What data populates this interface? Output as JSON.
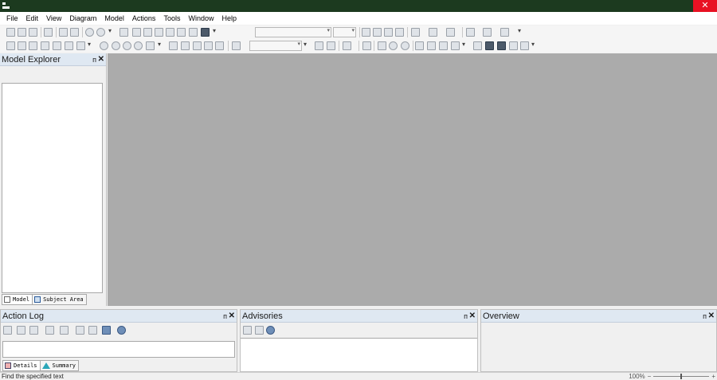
{
  "menu": [
    "File",
    "Edit",
    "View",
    "Diagram",
    "Model",
    "Actions",
    "Tools",
    "Window",
    "Help"
  ],
  "window": {
    "close_glyph": "✕"
  },
  "model_explorer": {
    "title": "Model Explorer",
    "tabs": [
      "Model",
      "Subject Area"
    ]
  },
  "action_log": {
    "title": "Action Log",
    "tabs": [
      "Details",
      "Summary"
    ]
  },
  "advisories": {
    "title": "Advisories"
  },
  "overview": {
    "title": "Overview"
  },
  "panel_controls": {
    "pin": "ᴨ",
    "close": "✕"
  },
  "status": {
    "text": "Find the specified text",
    "zoom": "100%",
    "zoom_minus": "−",
    "zoom_plus": "+"
  },
  "colors": {
    "titlebar": "#1c3a1f",
    "close": "#e81123",
    "canvas": "#ababab",
    "panel_header": "#dfe8f2"
  }
}
